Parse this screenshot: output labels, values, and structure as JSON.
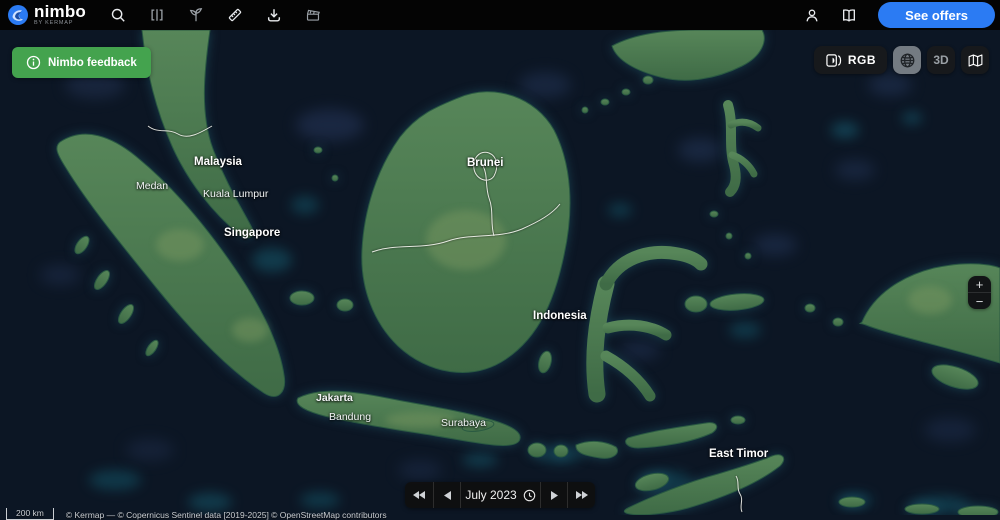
{
  "topbar": {
    "brand": {
      "name": "nimbo",
      "byline": "BY KERMAP"
    },
    "tools": [
      {
        "icon": "search-icon"
      },
      {
        "icon": "compare-icon"
      },
      {
        "icon": "vegetation-index-icon"
      },
      {
        "icon": "measure-icon"
      },
      {
        "icon": "download-icon"
      },
      {
        "icon": "timelapse-icon"
      }
    ],
    "account_icon": "user-icon",
    "docs_icon": "documentation-icon",
    "see_offers_label": "See offers"
  },
  "feedback_button": {
    "icon": "info-icon",
    "label": "Nimbo feedback"
  },
  "view_controls": {
    "rgb_label": "RGB",
    "rgb_icon": "layers-icon",
    "globe_icon": "globe-icon",
    "threed_label": "3D",
    "basemap_icon": "map-icon"
  },
  "zoom_control": {
    "zoom_in": "+",
    "zoom_out": "−"
  },
  "timeline": {
    "first_icon": "skip-back-icon",
    "prev_icon": "step-back-icon",
    "current_period": "July 2023",
    "clock_icon": "clock-icon",
    "next_icon": "step-forward-icon",
    "last_icon": "skip-forward-icon"
  },
  "map": {
    "labels": [
      {
        "text": "Malaysia",
        "type": "country"
      },
      {
        "text": "Brunei",
        "type": "country"
      },
      {
        "text": "Indonesia",
        "type": "country"
      },
      {
        "text": "East Timor",
        "type": "country"
      },
      {
        "text": "Singapore",
        "type": "country"
      },
      {
        "text": "Medan",
        "type": "city"
      },
      {
        "text": "Kuala Lumpur",
        "type": "city"
      },
      {
        "text": "Jakarta",
        "type": "city"
      },
      {
        "text": "Bandung",
        "type": "city"
      },
      {
        "text": "Surabaya",
        "type": "city"
      }
    ]
  },
  "attribution": {
    "scale_label": "200 km",
    "credits": "© Kermap — © Copernicus Sentinel data [2019-2025] © OpenStreetMap contributors"
  },
  "colors": {
    "accent_blue": "#2b7bf3",
    "feedback_green": "#44a34e",
    "ocean": "#0c1624",
    "land": "#4d7b50"
  }
}
